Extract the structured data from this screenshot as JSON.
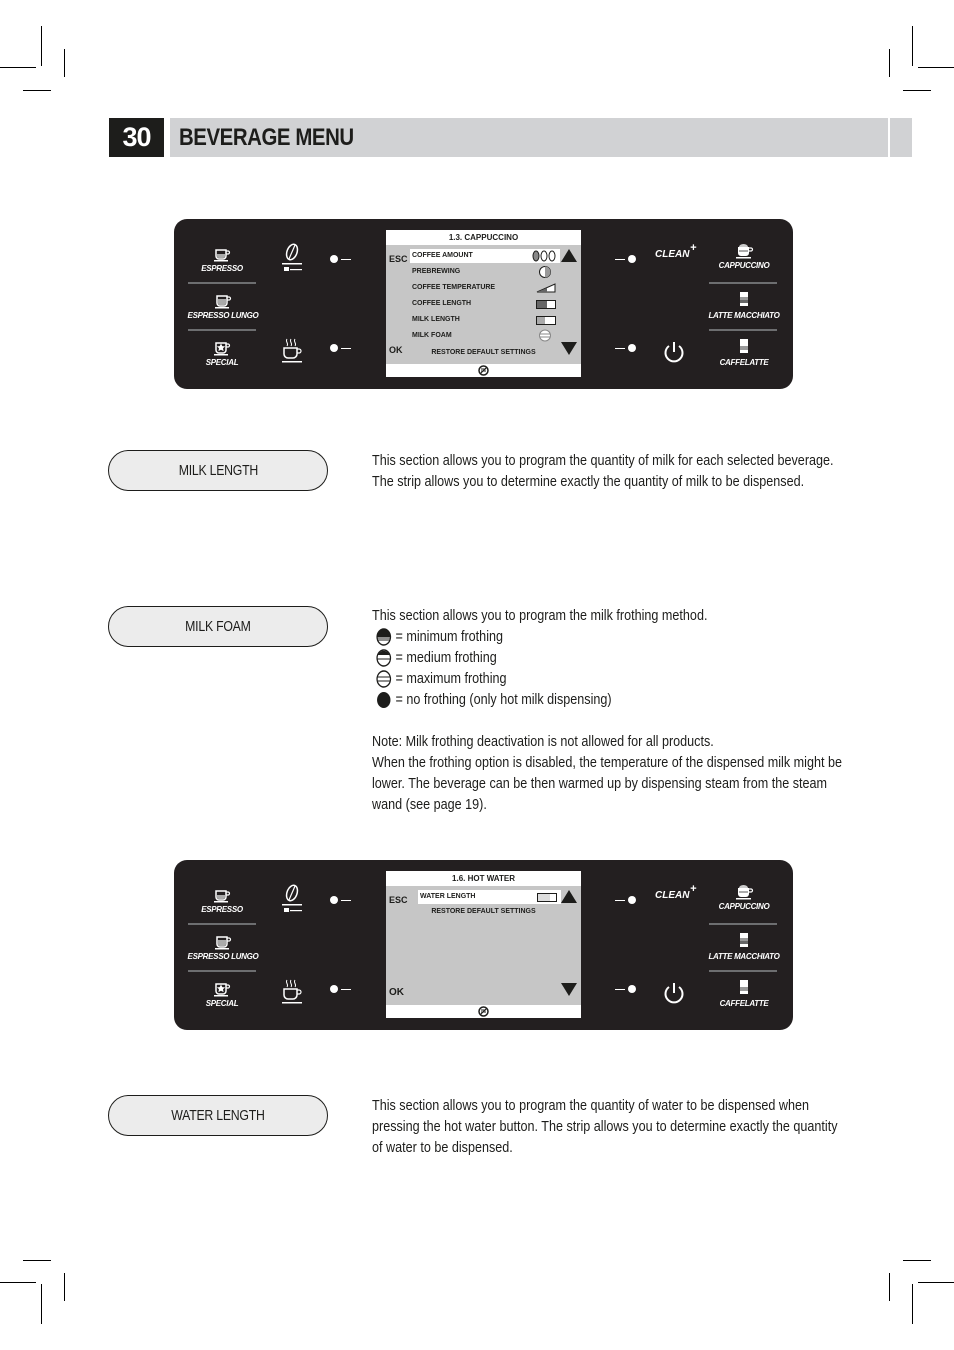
{
  "header": {
    "page_number": "30",
    "title": "BEVERAGE MENU"
  },
  "panel_buttons": {
    "left": [
      {
        "label": "ESPRESSO",
        "icon": "espresso-cup-icon"
      },
      {
        "label": "ESPRESSO LUNGO",
        "icon": "lungo-cup-icon"
      },
      {
        "label": "SPECIAL",
        "icon": "special-cup-icon"
      }
    ],
    "right": [
      {
        "label": "CAPPUCCINO",
        "icon": "cappuccino-cup-icon"
      },
      {
        "label": "LATTE MACCHIATO",
        "icon": "latte-glass-icon"
      },
      {
        "label": "CAFFELATTE",
        "icon": "caffelatte-glass-icon"
      }
    ],
    "clean_label": "CLEAN"
  },
  "screen1": {
    "title": "1.3. CAPPUCCINO",
    "esc": "ESC",
    "ok": "OK",
    "items": [
      {
        "label": "COFFEE AMOUNT",
        "indicator": "beans-1-of-3"
      },
      {
        "label": "PREBREWING",
        "indicator": "half-circle"
      },
      {
        "label": "COFFEE TEMPERATURE",
        "indicator": "temperature-steps"
      },
      {
        "label": "COFFEE LENGTH",
        "indicator": "strip",
        "level": 0.5
      },
      {
        "label": "MILK  LENGTH",
        "indicator": "strip",
        "level": 0.4
      },
      {
        "label": "MILK FOAM",
        "indicator": "foam-maximum"
      }
    ],
    "restore": "RESTORE DEFAULT SETTINGS"
  },
  "section_milk_length": {
    "label": "MILK LENGTH",
    "text": "This section allows you to program the quantity of milk for each selected beverage. The strip allows you to determine exactly the quantity of milk to be dispensed."
  },
  "section_milk_foam": {
    "label": "MILK FOAM",
    "intro": "This section allows you to program the milk frothing method.",
    "options": [
      {
        "icon": "foam-minimum-icon",
        "text": "= minimum frothing"
      },
      {
        "icon": "foam-medium-icon",
        "text": "= medium frothing"
      },
      {
        "icon": "foam-maximum-icon",
        "text": "= maximum frothing"
      },
      {
        "icon": "foam-none-icon",
        "text": "= no frothing (only hot milk dispensing)"
      }
    ],
    "note1": "Note: Milk frothing deactivation is not allowed for all products.",
    "note2": "When the frothing option is disabled, the temperature of the dispensed milk might be lower. The beverage can be then warmed up by dispensing steam from the steam wand (see page 19)."
  },
  "screen2": {
    "title": "1.6. HOT WATER",
    "esc": "ESC",
    "ok": "OK",
    "items": [
      {
        "label": "WATER LENGTH",
        "indicator": "strip",
        "level": 0.0
      }
    ],
    "restore": "RESTORE DEFAULT SETTINGS"
  },
  "section_water_length": {
    "label": "WATER LENGTH",
    "text": "This section allows you to program the quantity of water to be dispensed when pressing the hot water button. The strip allows you to determine exactly the quantity of water to be dispensed."
  }
}
